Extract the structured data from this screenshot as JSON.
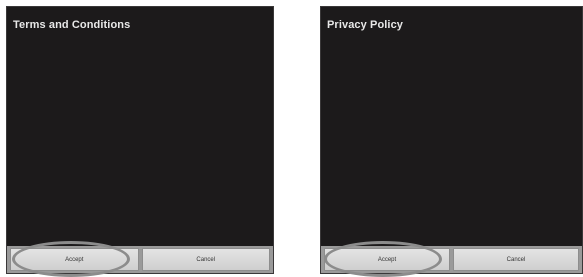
{
  "terms_dialog": {
    "title": "Terms and Conditions",
    "accept_label": "Accept",
    "cancel_label": "Cancel"
  },
  "privacy_dialog": {
    "title": "Privacy Policy",
    "accept_label": "Accept",
    "cancel_label": "Cancel"
  },
  "colors": {
    "screen_background": "#1c1a1b",
    "button_bar": "#9a9a9a",
    "highlight_ring": "#8c8c8c"
  }
}
